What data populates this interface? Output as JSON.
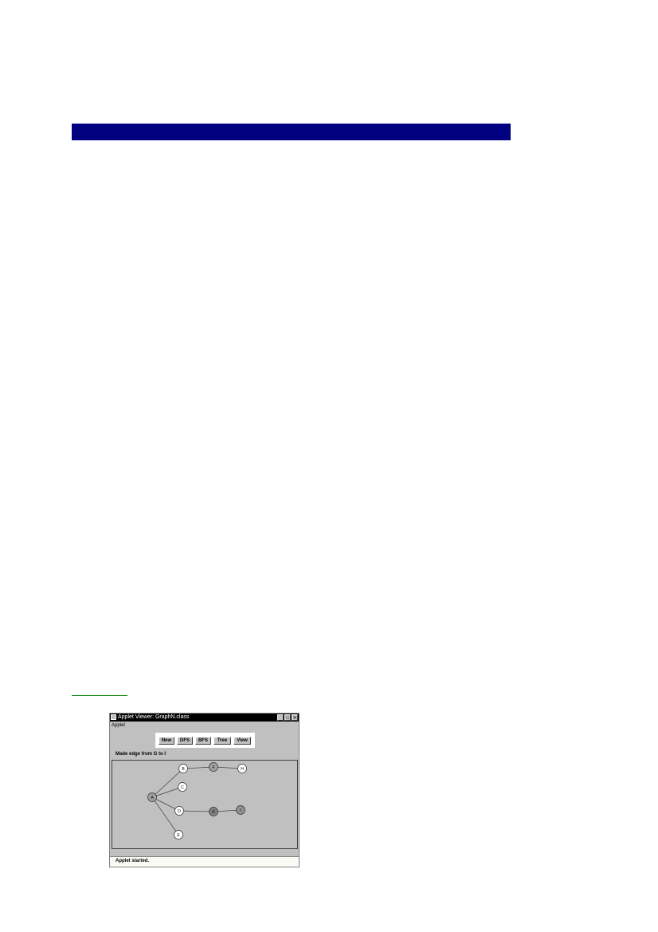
{
  "applet": {
    "title": "Applet Viewer: GraphN.class",
    "menu": "Applet",
    "buttons": [
      "New",
      "DFS",
      "BFS",
      "Tree",
      "View"
    ],
    "message": "Made edge from G to I",
    "status": "Applet started.",
    "window_controls": [
      "_",
      "□",
      "✕"
    ]
  },
  "graph": {
    "nodes": [
      {
        "id": "A",
        "fill": "#a0a0a0"
      },
      {
        "id": "B",
        "fill": "#ffffff"
      },
      {
        "id": "C",
        "fill": "#ffffff"
      },
      {
        "id": "D",
        "fill": "#ffffff"
      },
      {
        "id": "E",
        "fill": "#ffffff"
      },
      {
        "id": "F",
        "fill": "#a0a0a0"
      },
      {
        "id": "G",
        "fill": "#808080"
      },
      {
        "id": "H",
        "fill": "#ffffff"
      },
      {
        "id": "I",
        "fill": "#909090"
      }
    ],
    "edges": [
      [
        "A",
        "B"
      ],
      [
        "A",
        "C"
      ],
      [
        "A",
        "D"
      ],
      [
        "A",
        "E"
      ],
      [
        "B",
        "F"
      ],
      [
        "F",
        "H"
      ],
      [
        "D",
        "G"
      ],
      [
        "G",
        "I"
      ]
    ]
  },
  "colors": {
    "title_bar": "#000080",
    "rule": "#008000",
    "applet_bg": "#c0c0c0"
  }
}
